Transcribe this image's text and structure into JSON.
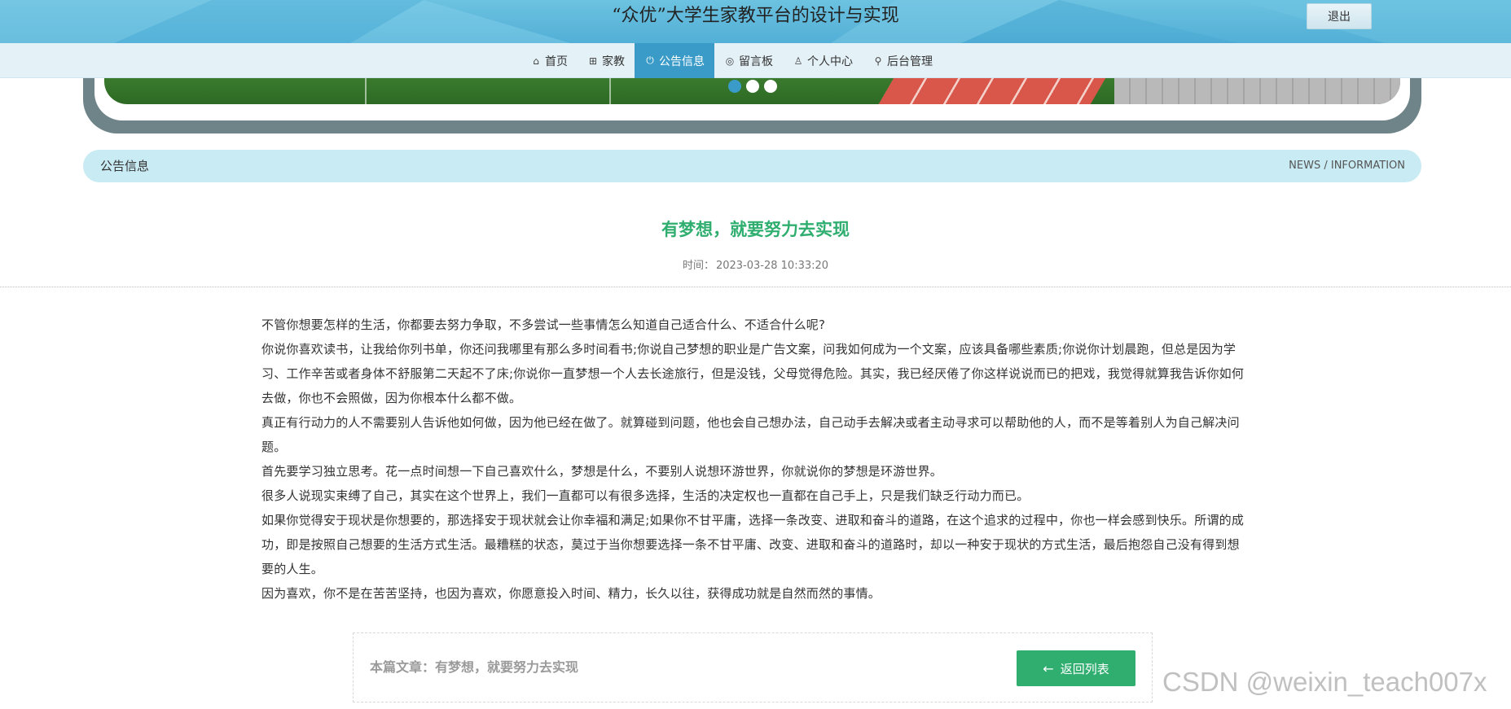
{
  "header": {
    "site_title": "“众优”大学生家教平台的设计与实现",
    "logout_label": "退出"
  },
  "nav": {
    "items": [
      {
        "label": "首页",
        "icon": "home-icon",
        "glyph": "⌂"
      },
      {
        "label": "家教",
        "icon": "gift-icon",
        "glyph": "⊞"
      },
      {
        "label": "公告信息",
        "icon": "power-icon",
        "glyph": "⏻",
        "active": true
      },
      {
        "label": "留言板",
        "icon": "globe-icon",
        "glyph": "◎"
      },
      {
        "label": "个人中心",
        "icon": "user-icon",
        "glyph": "♙"
      },
      {
        "label": "后台管理",
        "icon": "link-icon",
        "glyph": "⚲"
      }
    ]
  },
  "carousel": {
    "slide_count": 3,
    "active_index": 0
  },
  "section": {
    "title": "公告信息",
    "subtitle": "NEWS / INFORMATION"
  },
  "article": {
    "title": "有梦想，就要努力去实现",
    "time_label": "时间：",
    "time_value": "2023-03-28 10:33:20",
    "paragraphs": [
      "不管你想要怎样的生活，你都要去努力争取，不多尝试一些事情怎么知道自己适合什么、不适合什么呢?",
      "你说你喜欢读书，让我给你列书单，你还问我哪里有那么多时间看书;你说自己梦想的职业是广告文案，问我如何成为一个文案，应该具备哪些素质;你说你计划晨跑，但总是因为学习、工作辛苦或者身体不舒服第二天起不了床;你说你一直梦想一个人去长途旅行，但是没钱，父母觉得危险。其实，我已经厌倦了你这样说说而已的把戏，我觉得就算我告诉你如何去做，你也不会照做，因为你根本什么都不做。",
      "真正有行动力的人不需要别人告诉他如何做，因为他已经在做了。就算碰到问题，他也会自己想办法，自己动手去解决或者主动寻求可以帮助他的人，而不是等着别人为自己解决问题。",
      "首先要学习独立思考。花一点时间想一下自己喜欢什么，梦想是什么，不要别人说想环游世界，你就说你的梦想是环游世界。",
      "很多人说现实束缚了自己，其实在这个世界上，我们一直都可以有很多选择，生活的决定权也一直都在自己手上，只是我们缺乏行动力而已。",
      "如果你觉得安于现状是你想要的，那选择安于现状就会让你幸福和满足;如果你不甘平庸，选择一条改变、进取和奋斗的道路，在这个追求的过程中，你也一样会感到快乐。所谓的成功，即是按照自己想要的生活方式生活。最糟糕的状态，莫过于当你想要选择一条不甘平庸、改变、进取和奋斗的道路时，却以一种安于现状的方式生活，最后抱怨自己没有得到想要的人生。",
      "因为喜欢，你不是在苦苦坚持，也因为喜欢，你愿意投入时间、精力，长久以往，获得成功就是自然而然的事情。"
    ]
  },
  "footer": {
    "current_article": "本篇文章：有梦想，就要努力去实现",
    "back_label": "返回列表",
    "back_icon": "arrow-left-icon"
  },
  "watermark": "CSDN @weixin_teach007x",
  "colors": {
    "accent_blue": "#3a9bc8",
    "title_green": "#2fae6f",
    "section_bg": "#c9ebf4",
    "nav_bg": "#e4f1f7"
  }
}
